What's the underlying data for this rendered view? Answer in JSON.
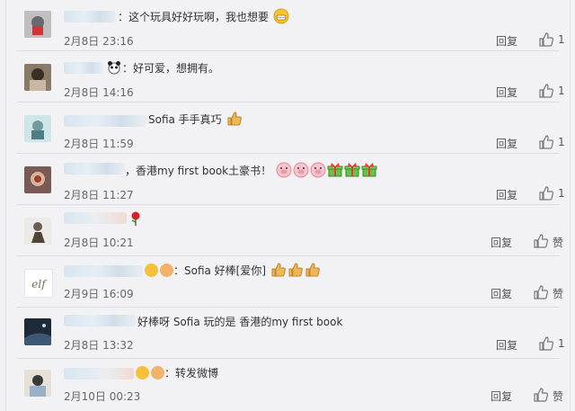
{
  "comments": [
    {
      "text": "：这个玩具好好玩啊，我也想要",
      "time": "2月8日 23:16",
      "reply": "回复",
      "likes": "1"
    },
    {
      "text": "：好可爱，想拥有。",
      "time": "2月8日 14:16",
      "reply": "回复",
      "likes": "1"
    },
    {
      "text": "Sofia 手手真巧",
      "time": "2月8日 11:59",
      "reply": "回复",
      "likes": "1"
    },
    {
      "text": "，香港my first book土豪书！",
      "time": "2月8日 11:27",
      "reply": "回复",
      "likes": "1"
    },
    {
      "text": "",
      "time": "2月8日 10:21",
      "reply": "回复",
      "likes": "赞"
    },
    {
      "text": "：Sofia 好棒[爱你]",
      "time": "2月9日 16:09",
      "reply": "回复",
      "likes": "赞"
    },
    {
      "text": "好棒呀 Sofia 玩的是 香港的my first book",
      "time": "2月8日 13:32",
      "reply": "回复",
      "likes": "1"
    },
    {
      "text": "：转发微博",
      "time": "2月10日 00:23",
      "reply": "回复",
      "likes": "赞"
    }
  ],
  "avatar_logo_text": "elf",
  "colors": {
    "background": "#f2f2f5",
    "divider": "#dcdce2",
    "text": "#333333",
    "meta": "#666666"
  },
  "icons": [
    "thumbs-up-icon",
    "grinning-face-emoji",
    "panda-emoji",
    "pig-face-emoji",
    "gift-emoji",
    "rose-emoji",
    "thumbs-up-emoji"
  ]
}
